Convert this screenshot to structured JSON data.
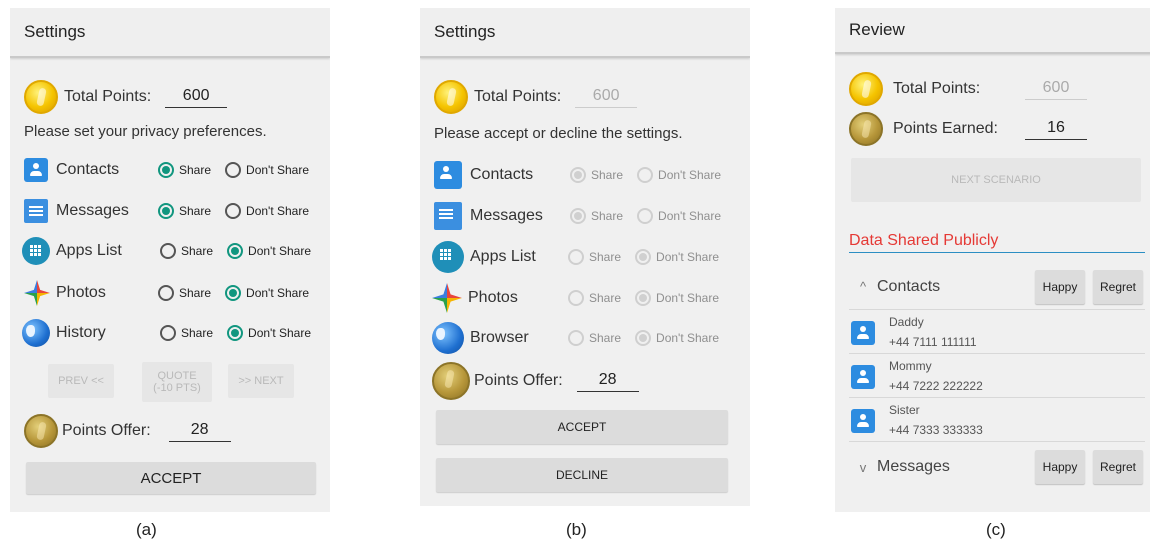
{
  "panel_a": {
    "title": "Settings",
    "total_points_label": "Total Points:",
    "total_points_value": "600",
    "instruction": "Please set your privacy preferences.",
    "categories": [
      {
        "label": "Contacts",
        "icon": "contacts-icon",
        "choice": "Share"
      },
      {
        "label": "Messages",
        "icon": "messages-icon",
        "choice": "Share"
      },
      {
        "label": "Apps List",
        "icon": "apps-list-icon",
        "choice": "Don't Share"
      },
      {
        "label": "Photos",
        "icon": "photos-icon",
        "choice": "Don't Share"
      },
      {
        "label": "History",
        "icon": "globe-icon",
        "choice": "Don't Share"
      }
    ],
    "option_share": "Share",
    "option_dont_share": "Don't Share",
    "prev_button": "PREV <<",
    "quote_button": "QUOTE (-10 PTS)",
    "next_button": ">> NEXT",
    "points_offer_label": "Points Offer:",
    "points_offer_value": "28",
    "accept_button": "ACCEPT",
    "caption": "(a)"
  },
  "panel_b": {
    "title": "Settings",
    "total_points_label": "Total Points:",
    "total_points_value": "600",
    "instruction": "Please accept or decline the settings.",
    "categories": [
      {
        "label": "Contacts",
        "icon": "contacts-icon",
        "choice": "Share"
      },
      {
        "label": "Messages",
        "icon": "messages-icon",
        "choice": "Share"
      },
      {
        "label": "Apps List",
        "icon": "apps-list-icon",
        "choice": "Don't Share"
      },
      {
        "label": "Photos",
        "icon": "photos-icon",
        "choice": "Don't Share"
      },
      {
        "label": "Browser",
        "icon": "globe-icon",
        "choice": "Don't Share"
      }
    ],
    "option_share": "Share",
    "option_dont_share": "Don't Share",
    "points_offer_label": "Points Offer:",
    "points_offer_value": "28",
    "accept_button": "ACCEPT",
    "decline_button": "DECLINE",
    "caption": "(b)"
  },
  "panel_c": {
    "title": "Review",
    "total_points_label": "Total Points:",
    "total_points_value": "600",
    "points_earned_label": "Points Earned:",
    "points_earned_value": "16",
    "next_scenario_button": "NEXT SCENARIO",
    "section_title": "Data Shared Publicly",
    "groups": [
      {
        "label": "Contacts",
        "chevron": "^",
        "happy": "Happy",
        "regret": "Regret"
      },
      {
        "label": "Messages",
        "chevron": "v",
        "happy": "Happy",
        "regret": "Regret"
      }
    ],
    "contacts": [
      {
        "name": "Daddy",
        "phone": "+44 7111 111111"
      },
      {
        "name": "Mommy",
        "phone": "+44 7222 222222"
      },
      {
        "name": "Sister",
        "phone": "+44 7333 333333"
      }
    ],
    "caption": "(c)"
  },
  "colors": {
    "accent_teal": "#11967f",
    "section_red": "#e53935",
    "divider_blue": "#2b8ec3"
  }
}
